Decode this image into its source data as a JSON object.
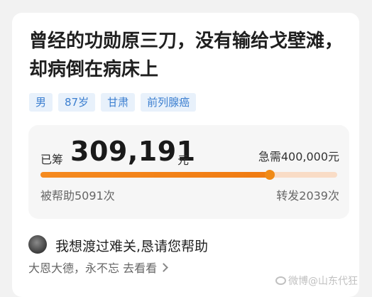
{
  "title": "曾经的功勋原三刀，没有输给戈壁滩，却病倒在病床上",
  "tags": [
    "男",
    "87岁",
    "甘肃",
    "前列腺癌"
  ],
  "fundraising": {
    "raised_label": "已筹",
    "raised_amount": "309,191",
    "raised_unit": "元",
    "target_text": "急需400,000元",
    "progress_fraction": 0.773,
    "helped_text": "被帮助5091次",
    "shared_text": "转发2039次"
  },
  "message": {
    "plea": "我想渡过难关,恳请您帮助",
    "subline": "大恩大德，永不忘 去看看"
  },
  "watermark": "微博@山东代狂",
  "colors": {
    "accent": "#f08a16",
    "tag_text": "#3c7fd0",
    "tag_bg": "#e8f1fb"
  }
}
